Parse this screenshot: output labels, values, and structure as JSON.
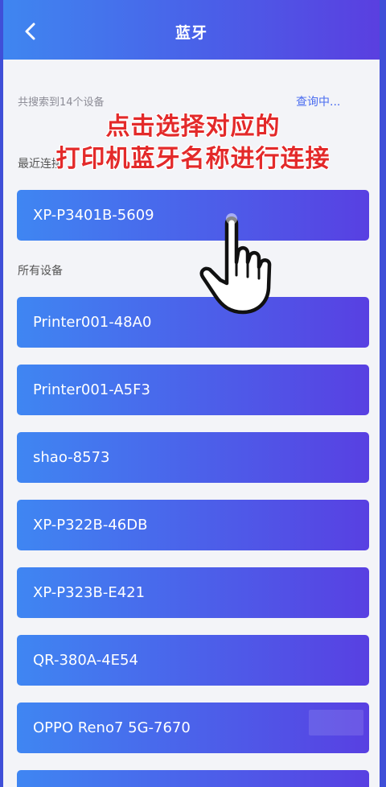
{
  "header": {
    "title": "蓝牙",
    "back_icon": "back-arrow-icon"
  },
  "scan": {
    "found_text": "共搜索到14个设备",
    "status_text": "查询中..."
  },
  "sections": {
    "recent_label": "最近连接",
    "all_label": "所有设备"
  },
  "recent_devices": [
    "XP-P3401B-5609"
  ],
  "all_devices": [
    "Printer001-48A0",
    "Printer001-A5F3",
    "shao-8573",
    "XP-P322B-46DB",
    "XP-P323B-E421",
    "QR-380A-4E54",
    "OPPO Reno7 5G-7670"
  ],
  "overlay": {
    "line1": "点击选择对应的",
    "line2": "打印机蓝牙名称进行连接",
    "color": "#e32a2a",
    "hand_icon": "pointing-hand-icon"
  },
  "colors": {
    "accent": "#4a6cf0",
    "gradient_start": "#3f86f2",
    "gradient_end": "#5840e2"
  }
}
